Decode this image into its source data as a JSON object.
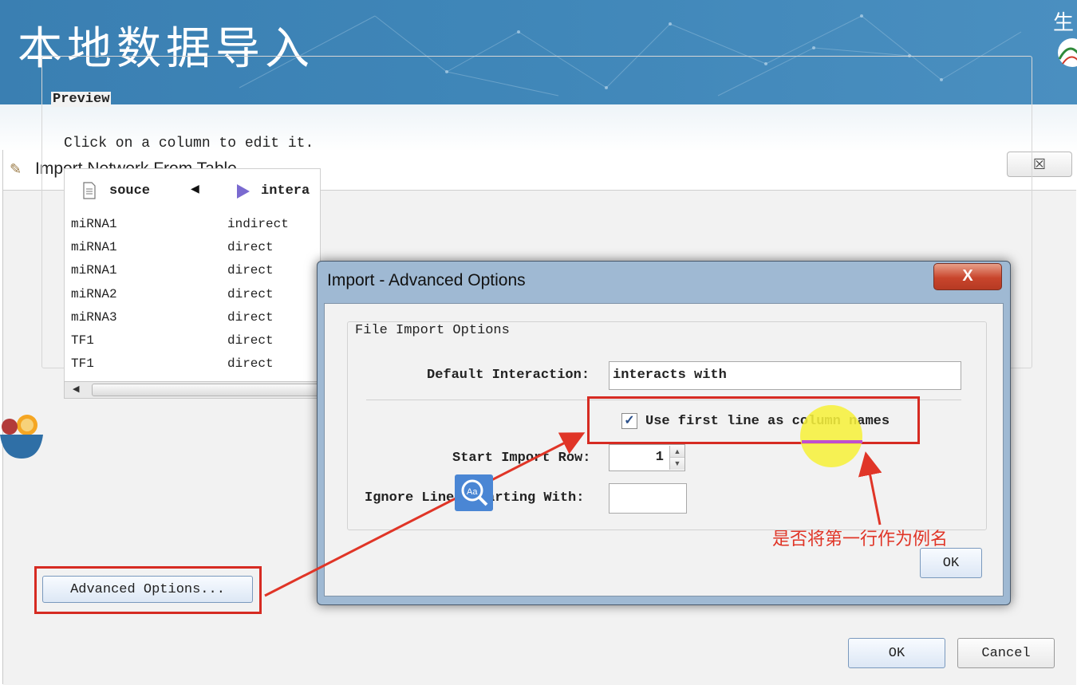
{
  "banner": {
    "title": "本地数据导入",
    "corner_char": "生"
  },
  "main_window": {
    "title": "Import Network From Table",
    "close_glyph": "☒",
    "preview_label": "Preview",
    "hint": "Click on a column to edit it.",
    "columns": [
      {
        "name": "souce",
        "icon": "document-icon"
      },
      {
        "name": "intera",
        "icon": "play-arrow-icon"
      }
    ],
    "rows": [
      [
        "miRNA1",
        "indirect"
      ],
      [
        "miRNA1",
        "direct"
      ],
      [
        "miRNA1",
        "direct"
      ],
      [
        "miRNA2",
        "direct"
      ],
      [
        "miRNA3",
        "direct"
      ],
      [
        "TF1",
        "direct"
      ],
      [
        "TF1",
        "direct"
      ]
    ],
    "advanced_button": "Advanced Options...",
    "ok_button": "OK",
    "cancel_button": "Cancel"
  },
  "dialog": {
    "title": "Import - Advanced Options",
    "close_glyph": "X",
    "group_label": "File Import Options",
    "default_interaction_label": "Default Interaction:",
    "default_interaction_value": "interacts with",
    "use_first_line_label": "Use first line as column names",
    "use_first_line_checked": true,
    "start_row_label": "Start Import Row:",
    "start_row_value": "1",
    "ignore_lines_label": "Ignore Lines Starting With:",
    "ignore_lines_value": "",
    "ok_button": "OK"
  },
  "annotation": {
    "text": "是否将第一行作为例名",
    "color": "#e03527"
  },
  "colors": {
    "banner": "#3f86b8",
    "highlight_red": "#d62b22",
    "dialog_frame": "#9fb9d3"
  }
}
